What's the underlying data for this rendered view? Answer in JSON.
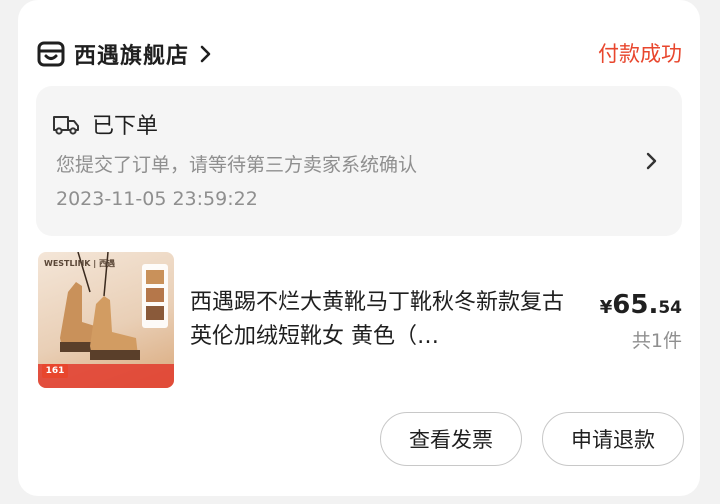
{
  "header": {
    "shop_name": "西遇旗舰店",
    "payment_status": "付款成功"
  },
  "order_status": {
    "title": "已下单",
    "description": "您提交了订单，请等待第三方卖家系统确认",
    "timestamp": "2023-11-05 23:59:22"
  },
  "product": {
    "title": "西遇踢不烂大黄靴马丁靴秋冬新款复古英伦加绒短靴女 黄色（…",
    "thumb_brand": "WESTLINK | 西遇",
    "thumb_badge": "161",
    "price_currency": "¥",
    "price_integer": "65.",
    "price_decimal": "54",
    "quantity": "共1件"
  },
  "actions": {
    "view_invoice": "查看发票",
    "request_refund": "申请退款"
  },
  "colors": {
    "accent": "#e8462d",
    "text_primary": "#1f1f1f",
    "text_secondary": "#8f8f8f"
  },
  "icons": {
    "shop": "store-icon",
    "truck": "truck-icon",
    "chevron": "chevron-right-icon"
  }
}
